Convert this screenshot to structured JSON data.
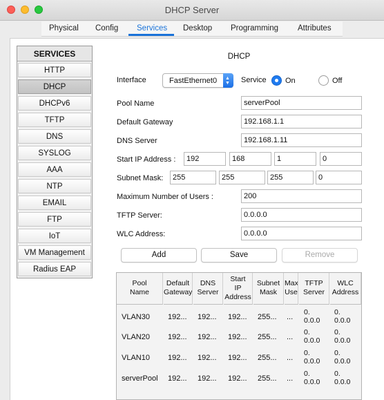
{
  "window": {
    "title": "DHCP Server"
  },
  "tabs": [
    {
      "label": "Physical"
    },
    {
      "label": "Config"
    },
    {
      "label": "Services"
    },
    {
      "label": "Desktop"
    },
    {
      "label": "Programming"
    },
    {
      "label": "Attributes"
    }
  ],
  "sidebar": {
    "header": "SERVICES",
    "items": [
      {
        "label": "HTTP"
      },
      {
        "label": "DHCP"
      },
      {
        "label": "DHCPv6"
      },
      {
        "label": "TFTP"
      },
      {
        "label": "DNS"
      },
      {
        "label": "SYSLOG"
      },
      {
        "label": "AAA"
      },
      {
        "label": "NTP"
      },
      {
        "label": "EMAIL"
      },
      {
        "label": "FTP"
      },
      {
        "label": "IoT"
      },
      {
        "label": "VM Management"
      },
      {
        "label": "Radius EAP"
      }
    ]
  },
  "dhcp": {
    "section_title": "DHCP",
    "interface_label": "Interface",
    "interface_value": "FastEthernet0",
    "service_label": "Service",
    "on_label": "On",
    "off_label": "Off",
    "pool_name_label": "Pool Name",
    "pool_name_value": "serverPool",
    "gateway_label": "Default Gateway",
    "gateway_value": "192.168.1.1",
    "dns_label": "DNS Server",
    "dns_value": "192.168.1.11",
    "start_ip_label": "Start IP Address :",
    "start_ip": [
      "192",
      "168",
      "1",
      "0"
    ],
    "subnet_label": "Subnet Mask:",
    "subnet": [
      "255",
      "255",
      "255",
      "0"
    ],
    "max_users_label": "Maximum Number of Users :",
    "max_users_value": "200",
    "tftp_label": "TFTP Server:",
    "tftp_value": "0.0.0.0",
    "wlc_label": "WLC Address:",
    "wlc_value": "0.0.0.0",
    "add_label": "Add",
    "save_label": "Save",
    "remove_label": "Remove"
  },
  "pool_table": {
    "columns": [
      {
        "l1": "Pool",
        "l2": "Name",
        "l3": ""
      },
      {
        "l1": "Default",
        "l2": "Gateway",
        "l3": ""
      },
      {
        "l1": "DNS",
        "l2": "Server",
        "l3": ""
      },
      {
        "l1": "Start",
        "l2": "IP",
        "l3": "Address"
      },
      {
        "l1": "Subnet",
        "l2": "Mask",
        "l3": ""
      },
      {
        "l1": "Max",
        "l2": "Use",
        "l3": ""
      },
      {
        "l1": "TFTP",
        "l2": "Server",
        "l3": ""
      },
      {
        "l1": "WLC",
        "l2": "Address",
        "l3": ""
      }
    ],
    "rows": [
      {
        "name": "VLAN30",
        "gateway": "192...",
        "dns": "192...",
        "start": "192...",
        "mask": "255...",
        "max": "...",
        "tftp_a": "0.",
        "tftp_b": "0.0.0",
        "wlc_a": "0.",
        "wlc_b": "0.0.0"
      },
      {
        "name": "VLAN20",
        "gateway": "192...",
        "dns": "192...",
        "start": "192...",
        "mask": "255...",
        "max": "...",
        "tftp_a": "0.",
        "tftp_b": "0.0.0",
        "wlc_a": "0.",
        "wlc_b": "0.0.0"
      },
      {
        "name": "VLAN10",
        "gateway": "192...",
        "dns": "192...",
        "start": "192...",
        "mask": "255...",
        "max": "...",
        "tftp_a": "0.",
        "tftp_b": "0.0.0",
        "wlc_a": "0.",
        "wlc_b": "0.0.0"
      },
      {
        "name": "serverPool",
        "gateway": "192...",
        "dns": "192...",
        "start": "192...",
        "mask": "255...",
        "max": "...",
        "tftp_a": "0.",
        "tftp_b": "0.0.0",
        "wlc_a": "0.",
        "wlc_b": "0.0.0"
      }
    ]
  },
  "colors": {
    "accent": "#1a73d9",
    "radio": "#1f7bf0"
  }
}
